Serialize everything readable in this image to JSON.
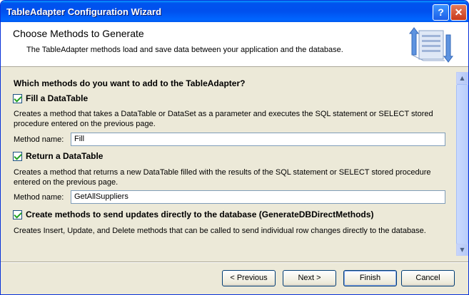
{
  "window": {
    "title": "TableAdapter Configuration Wizard"
  },
  "titlebar": {
    "help_glyph": "?",
    "close_glyph": "✕"
  },
  "header": {
    "title": "Choose Methods to Generate",
    "subtitle": "The TableAdapter methods load and save data between your application and the database.",
    "icon": "data-transfer-icon"
  },
  "content": {
    "question": "Which methods do you want to add to the TableAdapter?",
    "fill": {
      "checked": true,
      "label": "Fill a DataTable",
      "description": "Creates a method that takes a DataTable or DataSet as a parameter and executes the SQL statement or SELECT stored procedure entered on the previous page.",
      "name_label": "Method name:",
      "name_value": "Fill"
    },
    "return": {
      "checked": true,
      "label": "Return a DataTable",
      "description": "Creates a method that returns a new DataTable filled with the results of the SQL statement or SELECT stored procedure entered on the previous page.",
      "name_label": "Method name:",
      "name_value": "GetAllSuppliers"
    },
    "direct": {
      "checked": true,
      "label": "Create methods to send updates directly to the database (GenerateDBDirectMethods)",
      "description": "Creates Insert, Update, and Delete methods that can be called to send individual row changes directly to the database."
    }
  },
  "footer": {
    "previous": "< Previous",
    "next": "Next >",
    "finish": "Finish",
    "cancel": "Cancel"
  },
  "colors": {
    "titlebar": "#0054e3",
    "dialog": "#ece9d8",
    "accent": "#21a121"
  }
}
